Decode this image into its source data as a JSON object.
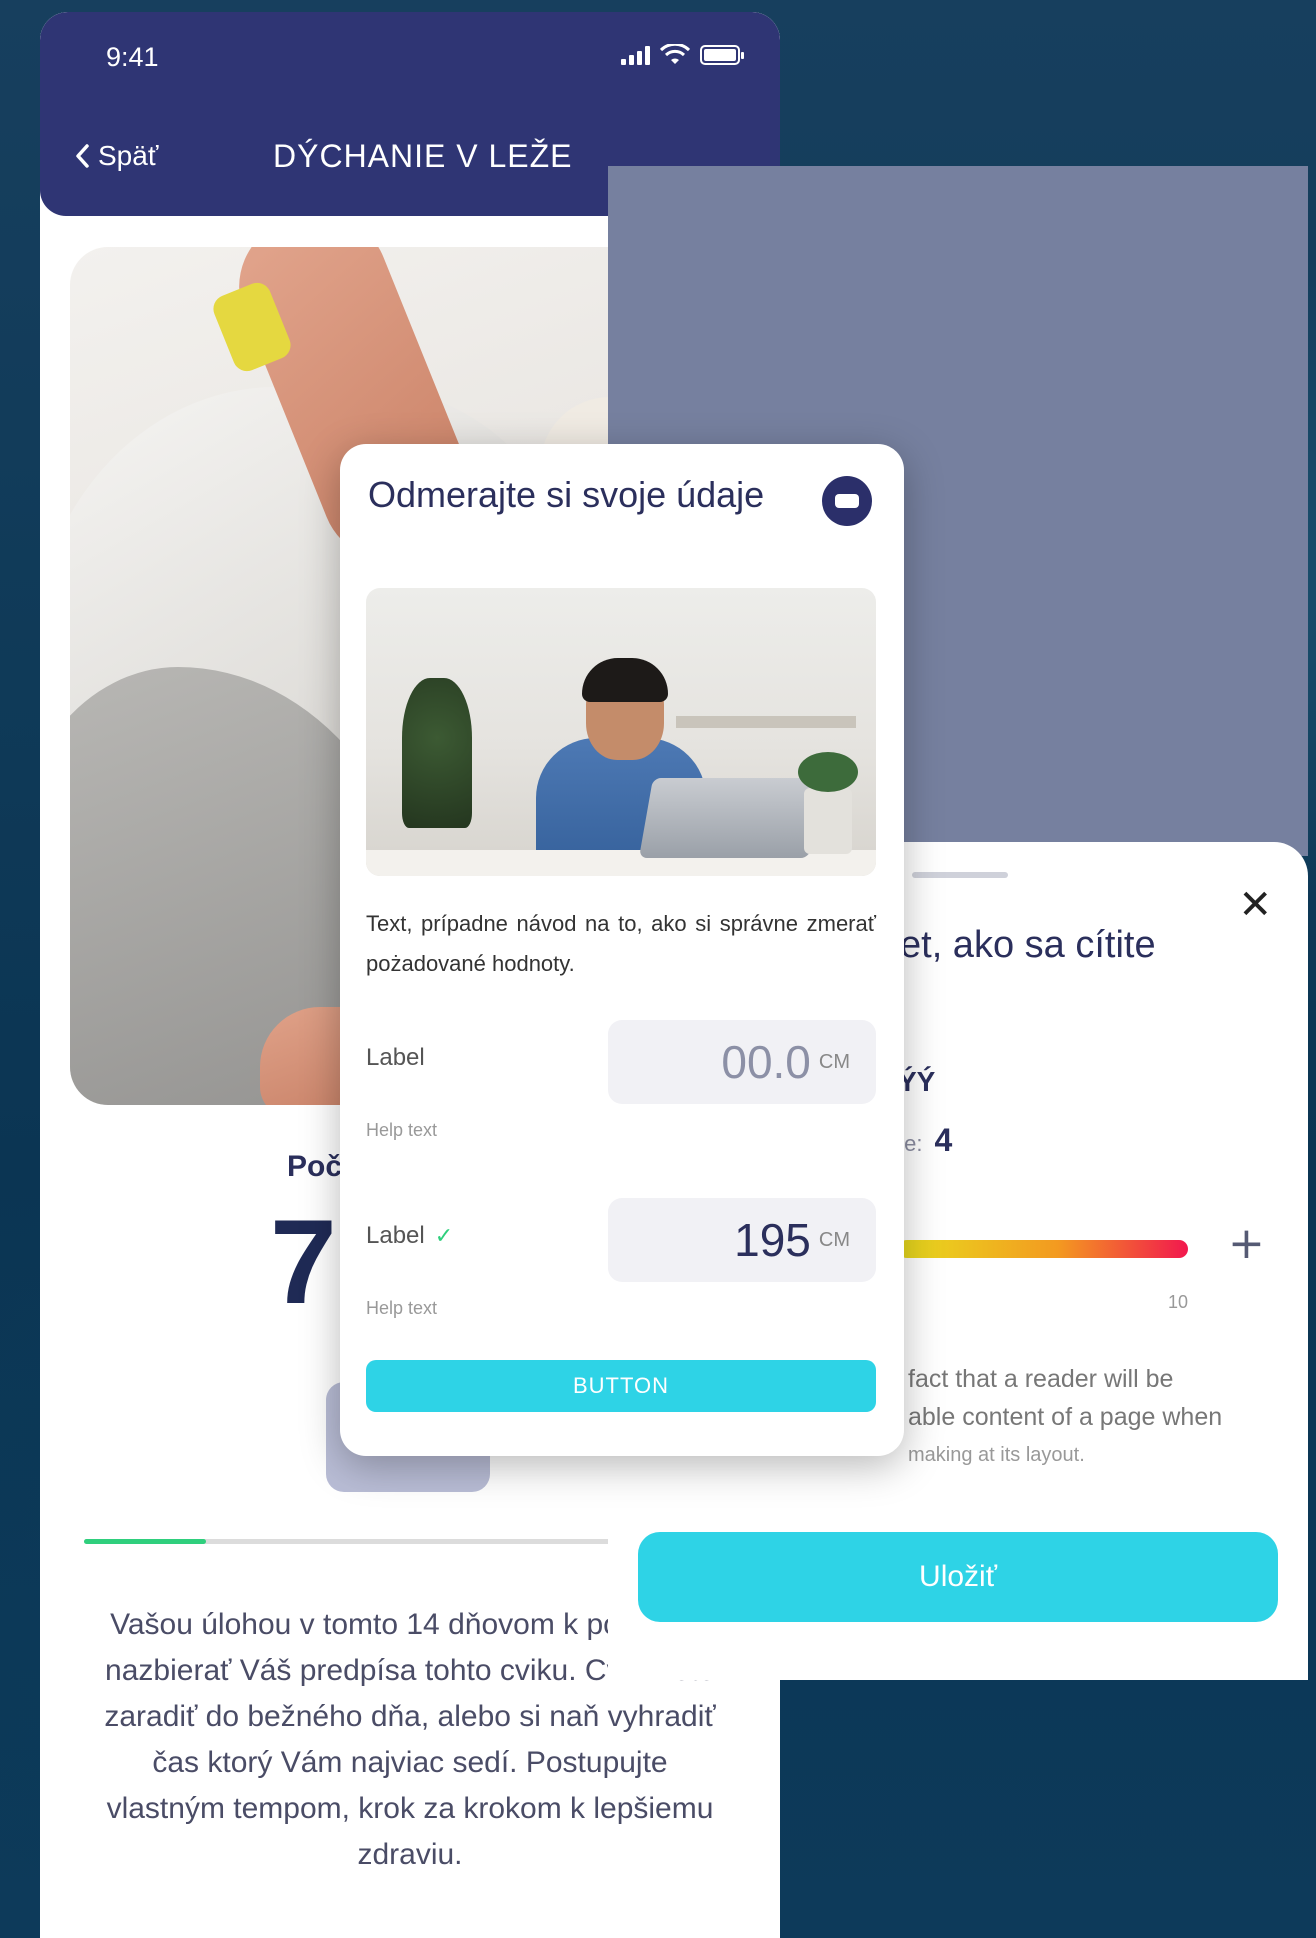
{
  "status_bar": {
    "time": "9:41"
  },
  "header": {
    "back_label": "Späť",
    "title": "DÝCHANIE V LEŽE"
  },
  "main": {
    "count_label": "Poč",
    "count_value": "7",
    "progress_percent": 18,
    "description": "Vašou úlohou v tomto 14 dňovom k postupne nazbierať Váš predpísa tohto cviku. Cvik viete zaradiť do bežného dňa, alebo si naň vyhradiť čas ktorý Vám najviac sedí. Postupujte vlastným tempom, krok za krokom k lepšiemu zdraviu."
  },
  "sheet": {
    "title_fragment": "et, ako sa cítite",
    "level_fragment": "ÝÝ",
    "score_label_fragment": "te:",
    "score_value": "4",
    "slider_max_label": "10",
    "paragraph_line1": "fact that a reader will be",
    "paragraph_line2": "able content of a page when",
    "paragraph_tail": "making at its layout.",
    "save_label": "Uložiť",
    "colors": {
      "slider_start": "#e8dc1e",
      "slider_mid": "#f39a20",
      "slider_end": "#f2184e",
      "save": "#2ed3e6"
    }
  },
  "card": {
    "title": "Odmerajte si svoje údaje",
    "text": "Text, prípadne návod na to, ako si správne zmerať pożadované hodnoty.",
    "fields": [
      {
        "label": "Label",
        "help": "Help text",
        "value": "00.0",
        "unit": "CM",
        "validated": false
      },
      {
        "label": "Label",
        "help": "Help text",
        "value": "195",
        "unit": "CM",
        "validated": true
      }
    ],
    "button_label": "BUTTON",
    "colors": {
      "primary": "#2ed3e6",
      "header": "#2f3574",
      "accent_green": "#2fcf7d"
    }
  }
}
